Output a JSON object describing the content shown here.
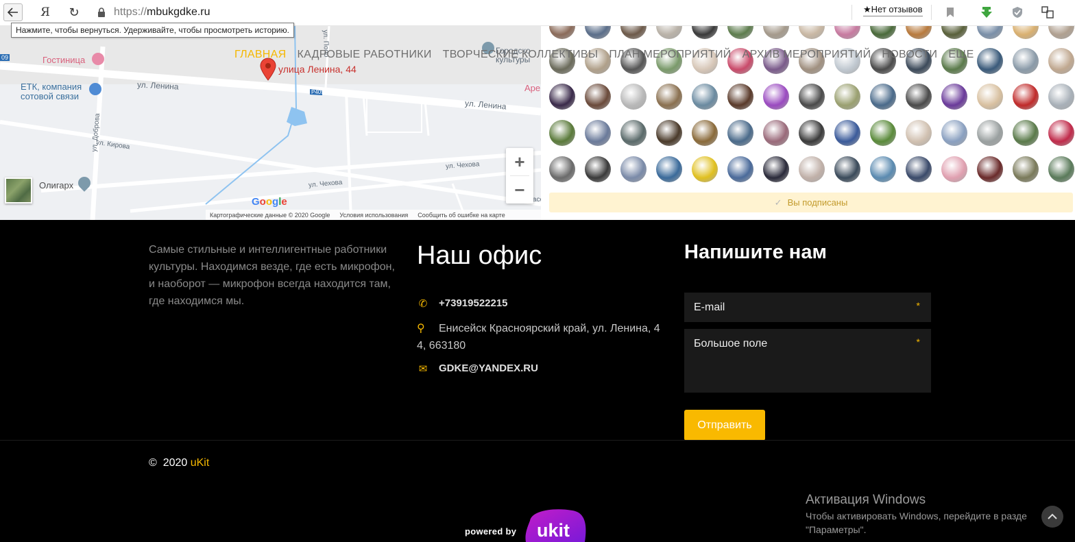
{
  "browser": {
    "url_proto": "https://",
    "url_host": "mbukgdke.ru",
    "back_tooltip": "Нажмите, чтобы вернуться. Удерживайте, чтобы просмотреть историю.",
    "reviews": "Нет отзывов",
    "ya_label": "Я"
  },
  "nav": {
    "items": [
      "ГЛАВНАЯ",
      "КАДРОВЫЕ РАБОТНИКИ",
      "ТВОРЧЕСКИЕ КОЛЛЕКТИВЫ",
      "ПЛАН МЕРОПРИЯТИЙ",
      "АРХИВ МЕРОПРИЯТИЙ",
      "НОВОСТИ",
      "ЕЩЕ"
    ],
    "active": "ГЛАВНАЯ"
  },
  "map": {
    "address_label": "улица Ленина, 44",
    "labels": {
      "hotel": "Гостиница",
      "etk_1": "ЕТК, компания",
      "etk_2": "сотовой связи",
      "lenina_1": "ул. Ленина",
      "lenina_2": "ул. Ленина",
      "kirova": "ул. Кирова",
      "dobrova": "ул. Доброва",
      "chekhova_1": "ул. Чехова",
      "chekhova_2": "ул. Чехова",
      "oligarkh": "Олигарх",
      "gorodskoy_1": "Городско",
      "gorodskoy_2": "культуры",
      "are": "Аре",
      "p409": "Р409",
      "nekrasova": "ул. Некрасо",
      "road_09": "09",
      "ul_pol": "ул. Попо"
    },
    "google": "Google",
    "footer": [
      "Картографические данные © 2020 Google",
      "Условия использования",
      "Сообщить об ошибке на карте"
    ],
    "zoom_in": "+",
    "zoom_out": "−"
  },
  "subscribers": {
    "status": "Вы подписаны",
    "avatar_colors": [
      "#8b6b5a",
      "#5b6e8a",
      "#6d5a4a",
      "#b9b2a8",
      "#3a3a3a",
      "#5e7d4e",
      "#a59a8c",
      "#c9b8a4",
      "#c77aa0",
      "#4a6a3a",
      "#b87a3d",
      "#59603a",
      "#7a8fa8",
      "#d9b070",
      "#b0a090",
      "#9a4a5a",
      "#6a6a5a",
      "#b0a08a",
      "#555555",
      "#7a9a6a",
      "#d7c7b8",
      "#c94a6a",
      "#7a5a8a",
      "#a09080",
      "#c0c8d0",
      "#4a4a4a",
      "#3c4a5a",
      "#5a7a4a",
      "#3a5a7a",
      "#8a9aa8",
      "#c0a890",
      "#7a8a9a",
      "#3a2a4a",
      "#6a4a3a",
      "#b8b8b8",
      "#8a7050",
      "#6a8aa0",
      "#5a3a2a",
      "#9a4ac0",
      "#4a4a4a",
      "#9aa070",
      "#4a6a8a",
      "#4a4a4a",
      "#6a3a9a",
      "#d8c0a0",
      "#c02a2a",
      "#a8b0b8",
      "#5a4a3a",
      "#5a7a3a",
      "#6a7a9a",
      "#5a6a6a",
      "#4a3a2a",
      "#8a6a3a",
      "#4a6a8a",
      "#9a6a7a",
      "#3a3a3a",
      "#3a5a9a",
      "#5a8a3a",
      "#d0c0b0",
      "#8aa0c0",
      "#9aa0a0",
      "#5a7a4a",
      "#c02a4a",
      "#3a3a3a",
      "#6a6a6a",
      "#3a3a3a",
      "#7a8aa8",
      "#3a6a9a",
      "#e0c020",
      "#4a6a9a",
      "#2a2a3a",
      "#c0b0a8",
      "#3a4a5a",
      "#5a8ab0",
      "#3a4a6a",
      "#e0a0b0",
      "#6a2a2a",
      "#7a7a5a",
      "#5a7a5a"
    ]
  },
  "footer": {
    "about": "Самые стильные и интеллигентные работники культуры. Находимся везде, где есть микрофон, и наоборот — микрофон всегда находится там, где находимся мы.",
    "office_title": "Наш офис",
    "phone": "+73919522215",
    "address": "Енисейск Красноярский край, ул. Ленина, 4 4, 663180",
    "email": "GDKE@YANDEX.RU",
    "write_title": "Напишите нам",
    "email_placeholder": "E-mail",
    "message_placeholder": "Большое поле",
    "required_mark": "*",
    "submit": "Отправить",
    "copyright_symbol": "©",
    "year": "2020",
    "brand": "uKit",
    "powered_by": "powered by",
    "logo_text": "ukit"
  },
  "windows": {
    "title": "Активация Windows",
    "line1": "Чтобы активировать Windows, перейдите в разде",
    "line2": "\"Параметры\"."
  }
}
